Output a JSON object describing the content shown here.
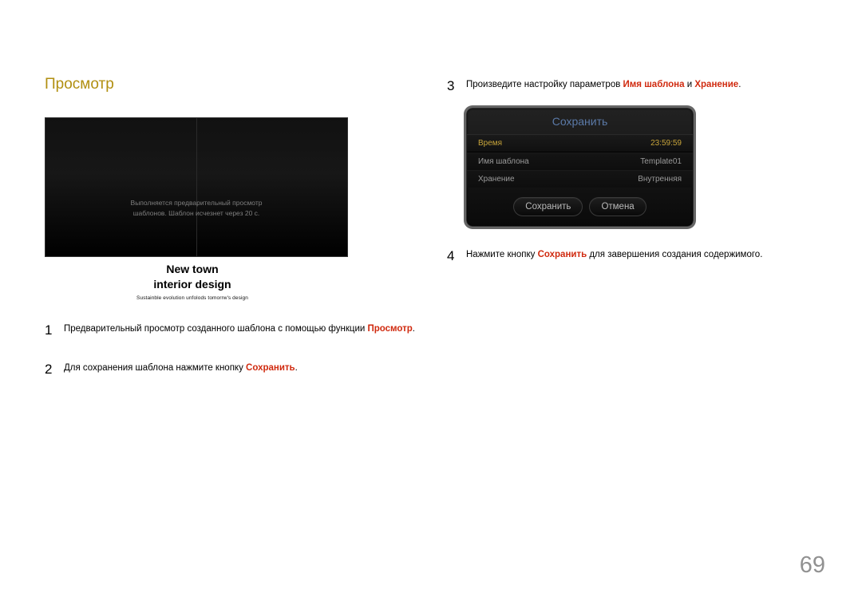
{
  "section_title": "Просмотр",
  "preview_toast_line1": "Выполняется предварительный просмотр",
  "preview_toast_line2": "шаблонов. Шаблон исчезнет через 20 с.",
  "caption_line1": "New town",
  "caption_line2": "interior design",
  "caption_sub": "Sustainble evolution unfolods tomorrw's design",
  "step1": {
    "num": "1",
    "text_a": "Предварительный просмотр созданного шаблона с помощью функции ",
    "kw": "Просмотр",
    "text_b": "."
  },
  "step2": {
    "num": "2",
    "text_a": "Для сохранения шаблона нажмите кнопку ",
    "kw": "Сохранить",
    "text_b": "."
  },
  "step3": {
    "num": "3",
    "text_a": "Произведите настройку параметров ",
    "kw1": "Имя шаблона",
    "mid": " и ",
    "kw2": "Хранение",
    "text_b": "."
  },
  "step4": {
    "num": "4",
    "text_a": "Нажмите кнопку ",
    "kw": "Сохранить",
    "text_b": " для завершения создания содержимого."
  },
  "dialog": {
    "title": "Сохранить",
    "rows": [
      {
        "label": "Время",
        "value": "23:59:59",
        "highlight": true
      },
      {
        "label": "Имя шаблона",
        "value": "Template01",
        "highlight": false
      },
      {
        "label": "Хранение",
        "value": "Внутренняя",
        "highlight": false
      }
    ],
    "save_btn": "Сохранить",
    "cancel_btn": "Отмена"
  },
  "page_number": "69"
}
